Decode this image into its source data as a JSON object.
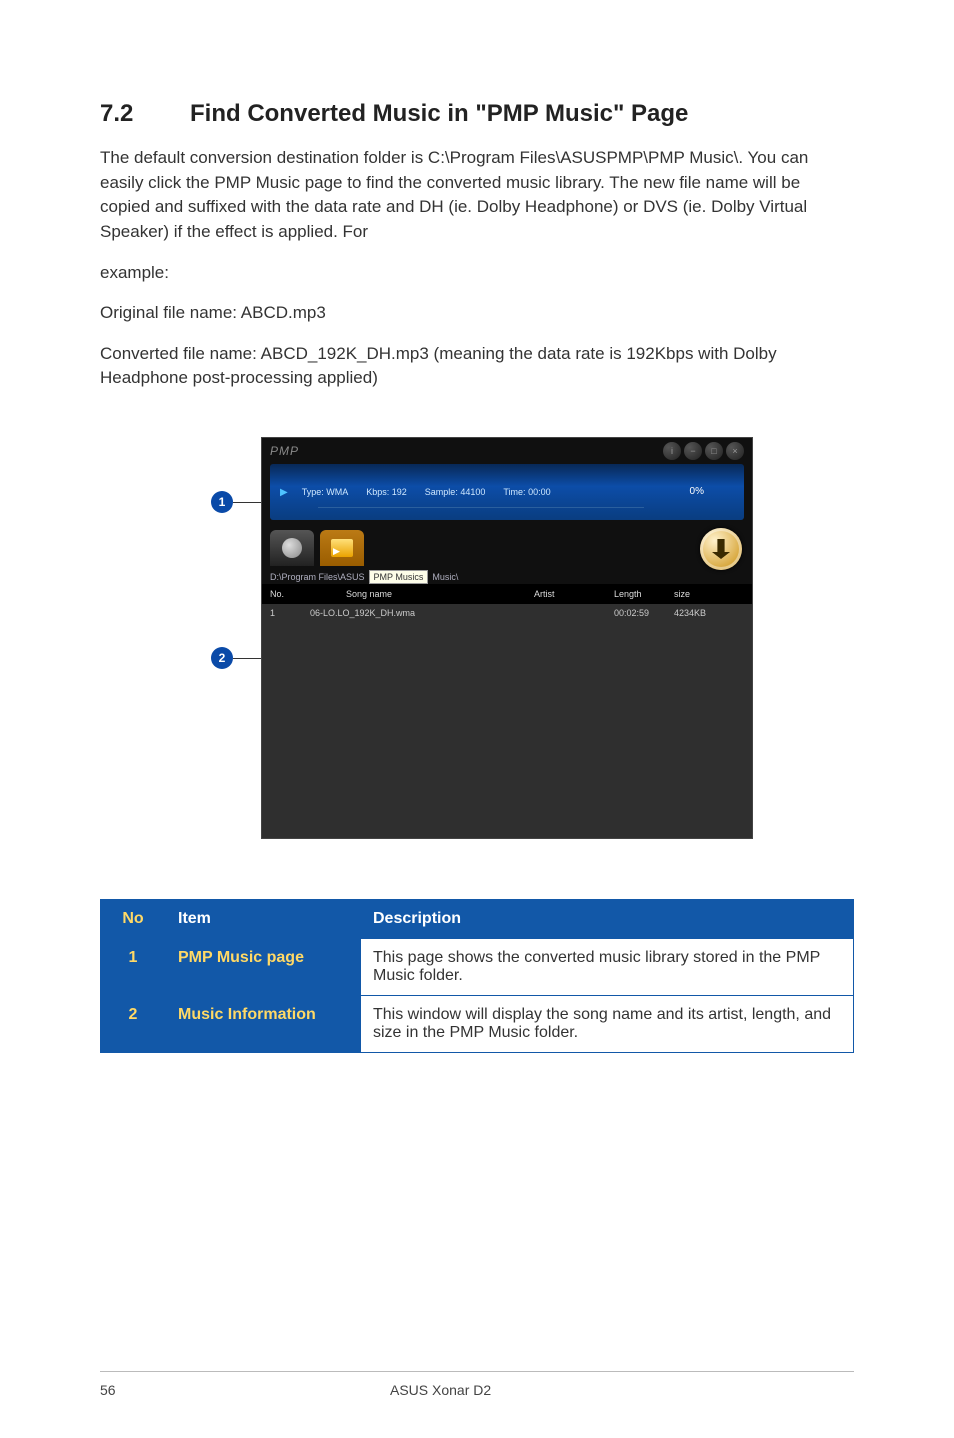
{
  "section": {
    "number": "7.2",
    "title": "Find Converted Music in \"PMP Music\" Page"
  },
  "para1": "The default conversion destination folder is C:\\Program Files\\ASUSPMP\\PMP Music\\. You can easily click the PMP Music page to find the converted music library. The new file name will be copied and suffixed with the data rate and DH (ie. Dolby Headphone) or DVS (ie. Dolby Virtual Speaker) if the effect is applied. For",
  "para1b": "example:",
  "para2": "Original file name: ABCD.mp3",
  "para3": "Converted file name: ABCD_192K_DH.mp3 (meaning the data rate is 192Kbps with Dolby Headphone post-processing applied)",
  "callouts": {
    "c1": "1",
    "c2": "2"
  },
  "app": {
    "title": "PMP",
    "player": {
      "type_label": "Type:",
      "type_value": "WMA",
      "kbps_label": "Kbps:",
      "kbps_value": "192",
      "sample_label": "Sample:",
      "sample_value": "44100",
      "time_label": "Time:",
      "time_value": "00:00",
      "progress": "0%"
    },
    "path_prefix": "D:\\Program Files\\ASUS",
    "path_tooltip": "PMP Musics",
    "path_suffix": "Music\\",
    "columns": {
      "no": "No.",
      "song": "Song name",
      "artist": "Artist",
      "length": "Length",
      "size": "size"
    },
    "rows": [
      {
        "no": "1",
        "song": "06-LO.LO_192K_DH.wma",
        "artist": "",
        "length": "00:02:59",
        "size": "4234KB"
      }
    ]
  },
  "table": {
    "headers": {
      "no": "No",
      "item": "Item",
      "description": "Description"
    },
    "rows": [
      {
        "no": "1",
        "item": "PMP Music page",
        "desc": "This page shows the converted music library stored in the PMP Music folder."
      },
      {
        "no": "2",
        "item": "Music Information",
        "desc": "This window will display the song name and its artist, length, and size in the PMP Music folder."
      }
    ]
  },
  "footer": {
    "page": "56",
    "title": "ASUS Xonar D2"
  }
}
